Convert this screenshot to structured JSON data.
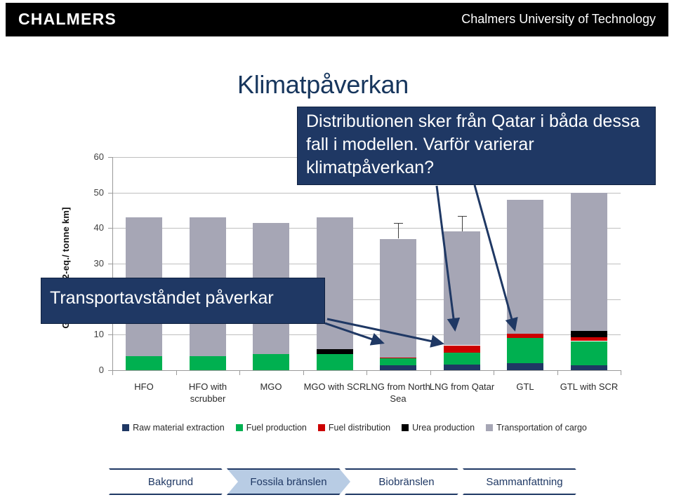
{
  "header": {
    "logo": "CHALMERS",
    "university": "Chalmers University of Technology"
  },
  "slide": {
    "title": "Klimatpåverkan"
  },
  "callouts": {
    "distribution": "Distributionen  sker från Qatar i båda dessa fall i modellen. Varför varierar klimatpåverkan?",
    "transport": "Transportavståndet påverkar"
  },
  "bottom_nav": {
    "items": [
      {
        "label": "Bakgrund",
        "active": false
      },
      {
        "label": "Fossila bränslen",
        "active": true
      },
      {
        "label": "Biobränslen",
        "active": false
      },
      {
        "label": "Sammanfattning",
        "active": false
      }
    ]
  },
  "colors": {
    "brand_dark_blue": "#1f3864",
    "raw_material_extraction": "#1f3864",
    "fuel_production": "#00b050",
    "fuel_distribution": "#cc0000",
    "urea_production": "#000000",
    "transportation_of_cargo": "#a6a6b5",
    "chart_grid": "#bfbfbf",
    "nav_active": "#b8cce4"
  },
  "chart_data": {
    "type": "bar",
    "title": "Klimatpåverkan",
    "stacked": true,
    "xlabel": "",
    "ylabel": "GHG [g CO2-eq./ tonne km]",
    "ylim": [
      0,
      60
    ],
    "yticks": [
      0,
      10,
      20,
      30,
      40,
      50,
      60
    ],
    "ytick_labels": [
      "0",
      "10",
      "20",
      "30",
      "40",
      "50",
      "60"
    ],
    "grid": true,
    "legend_position": "bottom",
    "categories": [
      "HFO",
      "HFO with scrubber",
      "MGO",
      "MGO with SCR",
      "LNG from North Sea",
      "LNG  from Qatar",
      "GTL",
      "GTL  with SCR"
    ],
    "series": [
      {
        "name": "Raw material extraction",
        "color": "#1f3864",
        "values": [
          0.0,
          0.0,
          0.0,
          0.0,
          1.3,
          1.5,
          2.0,
          1.4
        ]
      },
      {
        "name": "Fuel production",
        "color": "#00b050",
        "values": [
          4.0,
          4.0,
          4.5,
          4.5,
          2.0,
          3.5,
          7.0,
          6.8
        ]
      },
      {
        "name": "Fuel distribution",
        "color": "#cc0000",
        "values": [
          0.0,
          0.0,
          0.0,
          0.0,
          0.3,
          2.0,
          1.3,
          1.0
        ]
      },
      {
        "name": "Urea production",
        "color": "#000000",
        "values": [
          0.0,
          0.0,
          0.0,
          1.5,
          0.0,
          0.0,
          0.0,
          1.8
        ]
      },
      {
        "name": "Transportation of cargo",
        "color": "#a6a6b5",
        "values": [
          39.0,
          39.0,
          37.0,
          37.0,
          33.4,
          32.0,
          37.7,
          39.0
        ]
      }
    ],
    "totals": [
      43.0,
      43.0,
      41.5,
      43.0,
      37.0,
      39.0,
      48.0,
      50.0
    ],
    "error_bars": [
      {
        "category": "LNG from North Sea",
        "upper": 41.5,
        "lower": 37.0
      },
      {
        "category": "LNG  from Qatar",
        "upper": 43.5,
        "lower": 39.0
      }
    ]
  },
  "legend": {
    "items": [
      {
        "label": "Raw material extraction",
        "color": "#1f3864"
      },
      {
        "label": "Fuel production",
        "color": "#00b050"
      },
      {
        "label": "Fuel distribution",
        "color": "#cc0000"
      },
      {
        "label": "Urea production",
        "color": "#000000"
      },
      {
        "label": "Transportation of cargo",
        "color": "#a6a6b5"
      }
    ]
  }
}
